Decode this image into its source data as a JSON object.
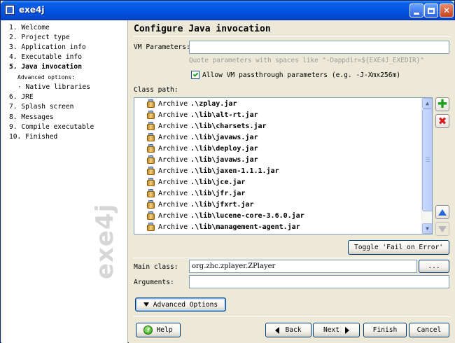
{
  "window": {
    "title": "exe4j",
    "app_icon": "exe4j-app-icon"
  },
  "sidebar": {
    "steps": [
      {
        "label": "1. Welcome"
      },
      {
        "label": "2. Project type"
      },
      {
        "label": "3. Application info"
      },
      {
        "label": "4. Executable info"
      },
      {
        "label": "5. Java invocation",
        "active": true
      },
      {
        "label": "Advanced options:",
        "sub": true
      },
      {
        "label": "· Native libraries",
        "sub_item": true
      },
      {
        "label": "6. JRE"
      },
      {
        "label": "7. Splash screen"
      },
      {
        "label": "8. Messages"
      },
      {
        "label": "9. Compile executable"
      },
      {
        "label": "10. Finished"
      }
    ],
    "brand": "exe4j"
  },
  "main": {
    "title": "Configure Java invocation",
    "vm_parameters": {
      "label": "VM Parameters:",
      "value": "",
      "hint": "Quote parameters with spaces like \"-Dappdir=${EXE4J_EXEDIR}\""
    },
    "passthrough": {
      "checked": true,
      "label": "Allow VM passthrough parameters (e.g. -J-Xmx256m)"
    },
    "classpath": {
      "label": "Class path:",
      "entries": [
        {
          "type": "Archive",
          "path": ".\\zplay.jar"
        },
        {
          "type": "Archive",
          "path": ".\\lib\\alt-rt.jar"
        },
        {
          "type": "Archive",
          "path": ".\\lib\\charsets.jar"
        },
        {
          "type": "Archive",
          "path": ".\\lib\\javaws.jar"
        },
        {
          "type": "Archive",
          "path": ".\\lib\\deploy.jar"
        },
        {
          "type": "Archive",
          "path": ".\\lib\\javaws.jar"
        },
        {
          "type": "Archive",
          "path": ".\\lib\\jaxen-1.1.1.jar"
        },
        {
          "type": "Archive",
          "path": ".\\lib\\jce.jar"
        },
        {
          "type": "Archive",
          "path": ".\\lib\\jfr.jar"
        },
        {
          "type": "Archive",
          "path": ".\\lib\\jfxrt.jar"
        },
        {
          "type": "Archive",
          "path": ".\\lib\\lucene-core-3.6.0.jar"
        },
        {
          "type": "Archive",
          "path": ".\\lib\\management-agent.jar"
        }
      ],
      "buttons": {
        "add_icon": "plus-icon",
        "remove_icon": "remove-icon",
        "up_icon": "move-up-icon",
        "down_icon": "move-down-icon"
      },
      "toggle_label": "Toggle 'Fail on Error'"
    },
    "main_class": {
      "label": "Main class:",
      "value": "org.zhc.zplayer.ZPlayer",
      "browse_label": "..."
    },
    "arguments": {
      "label": "Arguments:",
      "value": ""
    },
    "advanced_label": "Advanced Options"
  },
  "footer": {
    "help": "Help",
    "back": "Back",
    "next": "Next",
    "finish": "Finish",
    "cancel": "Cancel"
  },
  "colors": {
    "titlebar": "#0554e2",
    "panel": "#ece9d8",
    "input_border": "#7f9db9",
    "add_green": "#1c9e1c",
    "remove_red": "#d61c1c"
  }
}
